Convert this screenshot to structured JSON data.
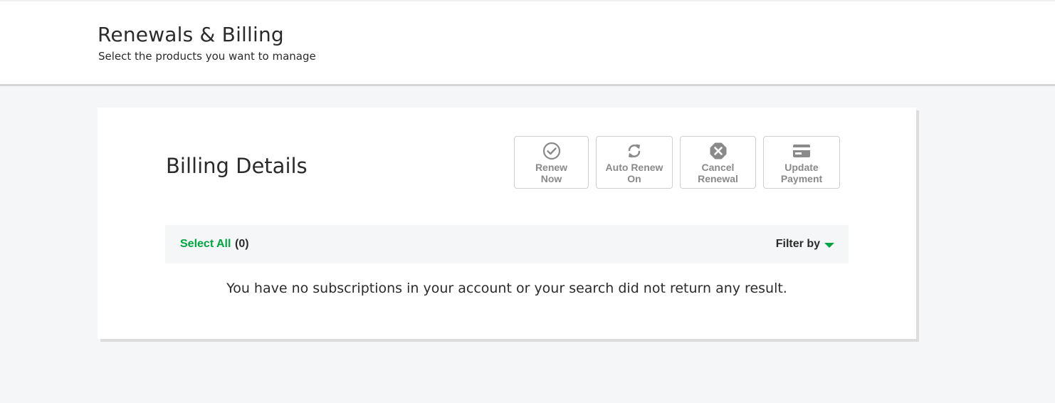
{
  "header": {
    "title": "Renewals & Billing",
    "subtitle": "Select the products you want to manage"
  },
  "billing": {
    "title": "Billing Details",
    "actions": [
      {
        "label": "Renew\nNow",
        "icon": "check-circle-icon"
      },
      {
        "label": "Auto Renew\nOn",
        "icon": "refresh-icon"
      },
      {
        "label": "Cancel\nRenewal",
        "icon": "cancel-octagon-icon"
      },
      {
        "label": "Update\nPayment",
        "icon": "credit-card-icon"
      }
    ],
    "toolbar": {
      "select_all": "Select All",
      "count": "(0)",
      "filter_by": "Filter by"
    },
    "empty_message": "You have no subscriptions in your account or your search did not return any result."
  },
  "colors": {
    "accent": "#00a63f",
    "icon_gray": "#8a8a8a",
    "background": "#f5f6f7"
  }
}
